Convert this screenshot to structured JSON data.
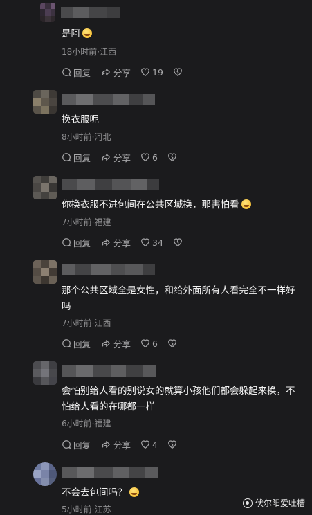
{
  "colors": {
    "background": "#1b1b1d",
    "text": "#f1f1f1",
    "meta": "#8e8e90",
    "action": "#a8a8aa"
  },
  "comments": [
    {
      "text": "是阿",
      "emoji": "grinning-face",
      "meta": "18小时前·江西",
      "reply": "回复",
      "share": "分享",
      "likes": "19"
    },
    {
      "text": "换衣服呢",
      "meta": "8小时前·河北",
      "reply": "回复",
      "share": "分享",
      "likes": "6"
    },
    {
      "text": "你换衣服不进包间在公共区域换，那害怕看",
      "emoji": "rofl-face",
      "meta": "7小时前·福建",
      "reply": "回复",
      "share": "分享",
      "likes": "34"
    },
    {
      "text": "那个公共区域全是女性，和给外面所有人看完全不一样好吗",
      "meta": "7小时前·江西",
      "reply": "回复",
      "share": "分享",
      "likes": "6"
    },
    {
      "text": "会怕别给人看的别说女的就算小孩他们都会躲起来换，不怕给人看的在哪都一样",
      "meta": "6小时前·福建",
      "reply": "回复",
      "share": "分享",
      "likes": "4"
    },
    {
      "text": "不会去包间吗？",
      "emoji": "rofl-face",
      "meta": "5小时前·江苏"
    }
  ],
  "watermark": {
    "text": "伏尔阳爱吐槽",
    "icon": "watermark-logo-icon"
  }
}
